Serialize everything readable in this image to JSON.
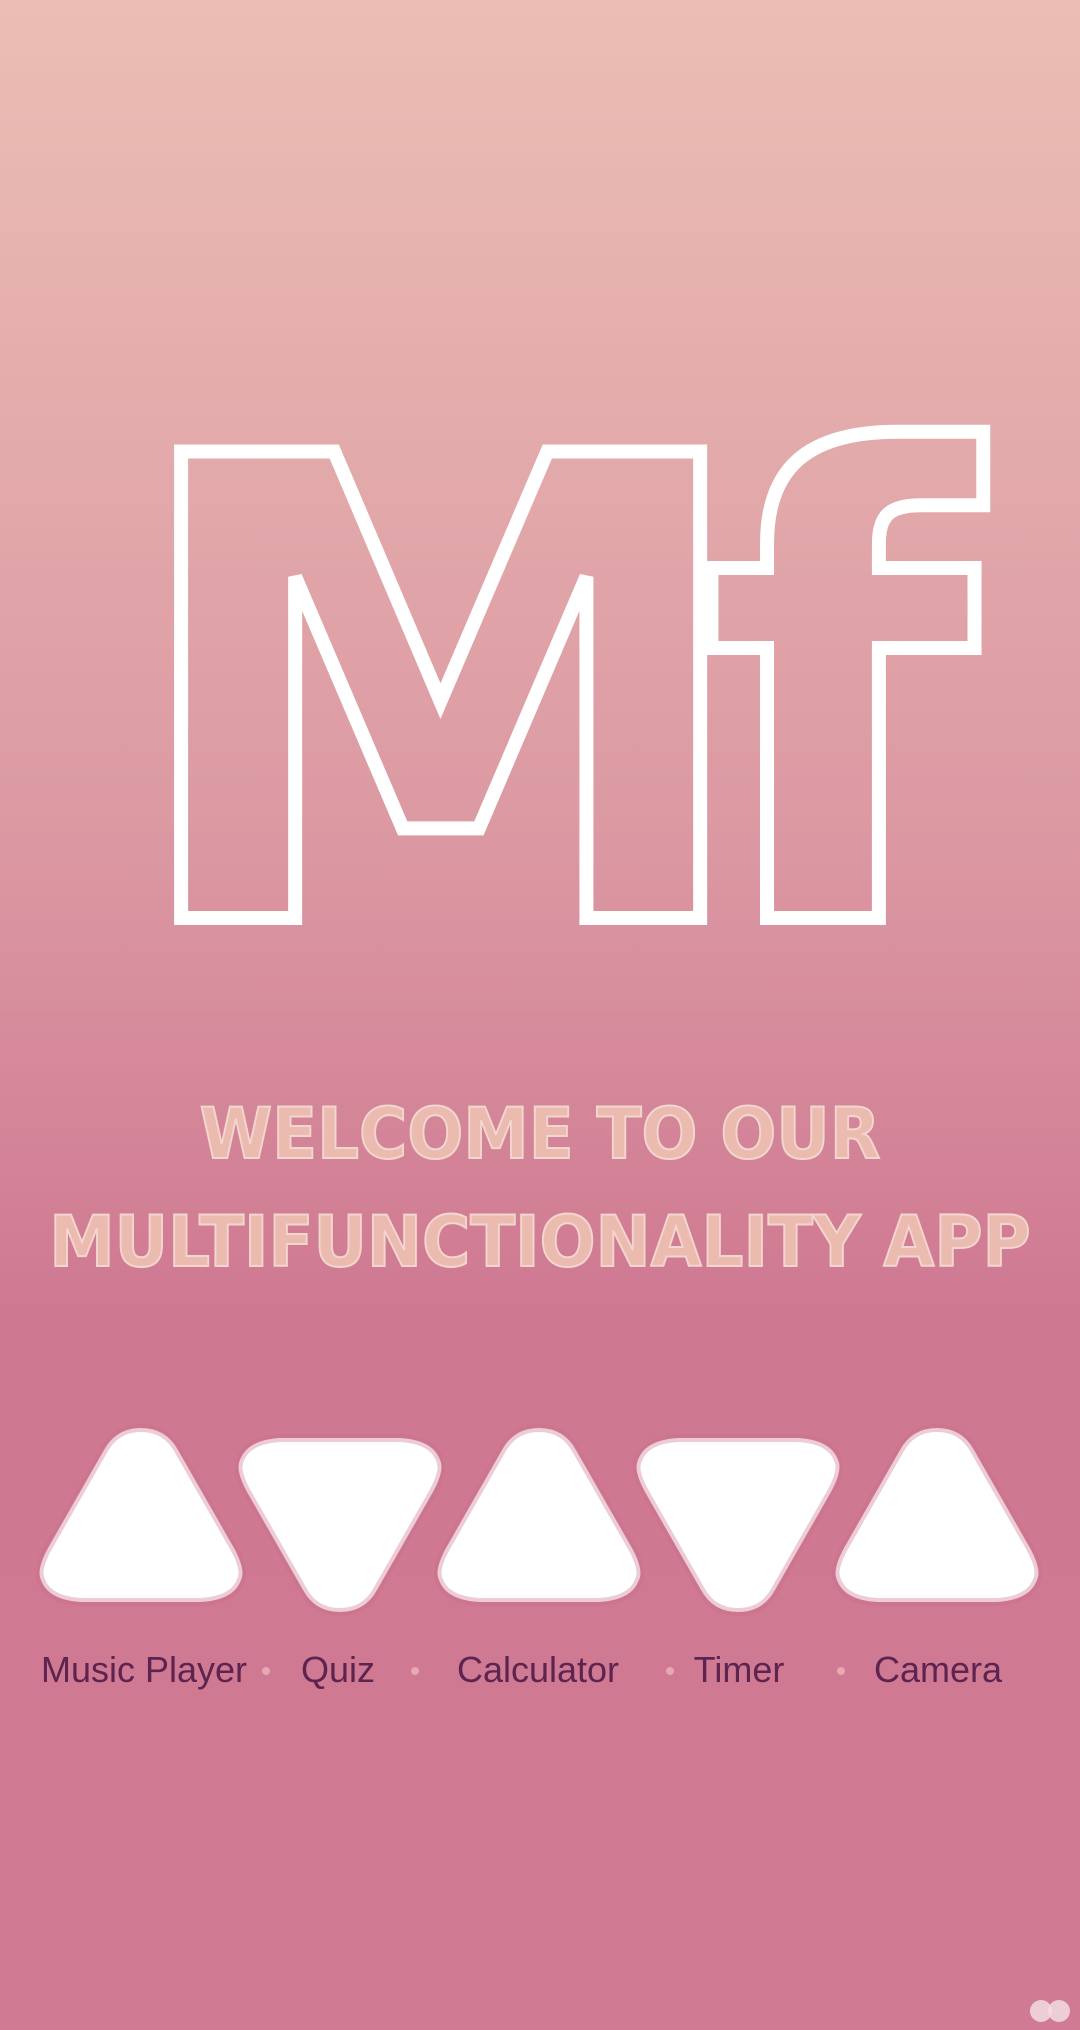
{
  "logo": {
    "text": "Mf"
  },
  "welcome": {
    "line1": "WELCOME TO OUR",
    "line2": "MULTIFUNCTIONALITY APP"
  },
  "apps": [
    {
      "label": "Music Player",
      "icon": "triangle-up-icon"
    },
    {
      "label": "Quiz",
      "icon": "triangle-down-icon"
    },
    {
      "label": "Calculator",
      "icon": "triangle-up-icon"
    },
    {
      "label": "Timer",
      "icon": "triangle-down-icon"
    },
    {
      "label": "Camera",
      "icon": "triangle-up-icon"
    }
  ],
  "colors": {
    "background_top": "#ebbeb4",
    "background_bottom": "#d07a93",
    "title": "#ebbbaf",
    "label": "#5e2450",
    "icon_fill": "#ffffff"
  }
}
